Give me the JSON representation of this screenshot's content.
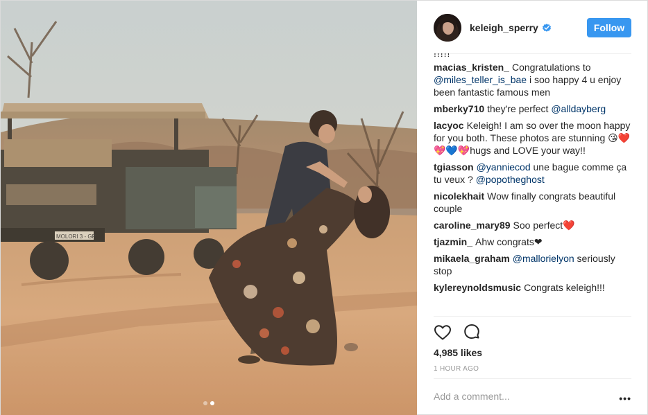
{
  "post": {
    "author": "keleigh_sperry",
    "verified": true,
    "follow_label": "Follow",
    "likes": "4,985 likes",
    "time": "1 HOUR AGO",
    "comment_placeholder": "Add a comment...",
    "more_label": "•••"
  },
  "comments_header": "!!!!!",
  "comments": [
    {
      "user": "macias_kristen_",
      "parts": [
        {
          "t": "Congratulations to "
        },
        {
          "m": "@miles_teller_is_bae"
        },
        {
          "t": " i soo happy 4 u enjoy been fantastic famous men"
        }
      ]
    },
    {
      "user": "mberky710",
      "parts": [
        {
          "t": "they're perfect "
        },
        {
          "m": "@alldayberg"
        }
      ]
    },
    {
      "user": "lacyoc",
      "parts": [
        {
          "t": "Keleigh! I am so over the moon happy for you both. These photos are stunning 😘❤️💖💙💖hugs and LOVE your way!!"
        }
      ]
    },
    {
      "user": "tgiasson",
      "parts": [
        {
          "m": "@yanniecod"
        },
        {
          "t": " une bague comme ça tu veux ? "
        },
        {
          "m": "@popotheghost"
        }
      ]
    },
    {
      "user": "nicolekhait",
      "parts": [
        {
          "t": "Wow finally congrats beautiful couple"
        }
      ]
    },
    {
      "user": "caroline_mary89",
      "parts": [
        {
          "t": "Soo perfect❤️"
        }
      ]
    },
    {
      "user": "tjazmin_",
      "parts": [
        {
          "t": "Ahw congrats❤"
        }
      ]
    },
    {
      "user": "mikaela_graham",
      "parts": [
        {
          "m": "@mallorielyon"
        },
        {
          "t": " seriously stop"
        }
      ]
    },
    {
      "user": "kylereynoldsmusic",
      "parts": [
        {
          "t": "Congrats keleigh!!!"
        }
      ]
    }
  ],
  "vehicle_plate": "MOLORI 3 - GP",
  "icons": {
    "like": "heart-icon",
    "comment": "comment-icon",
    "verified": "verified-badge-icon",
    "more": "more-options-icon"
  },
  "colors": {
    "follow": "#3897f0",
    "mention": "#003569",
    "verified": "#3897f0",
    "muted": "#999999"
  },
  "carousel": {
    "count": 2,
    "active": 2
  }
}
